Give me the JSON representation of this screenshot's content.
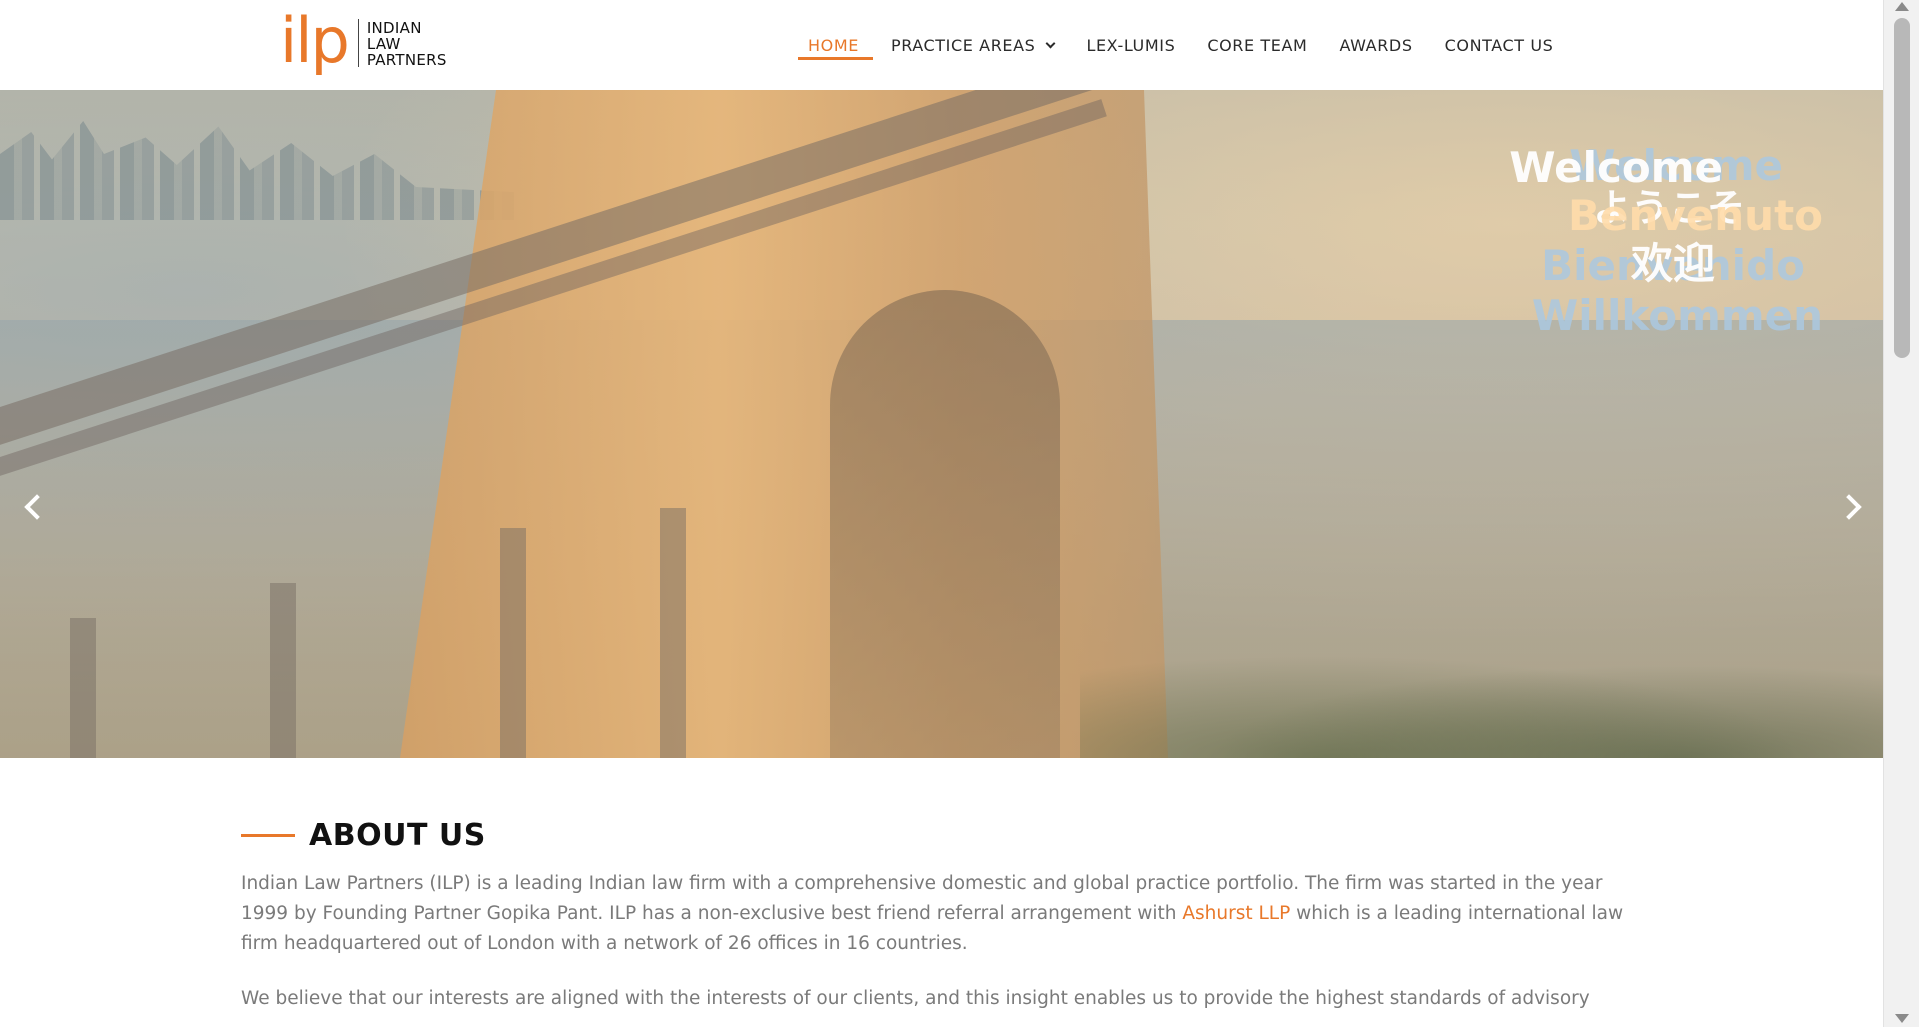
{
  "logo": {
    "mark": "ilp",
    "words": [
      "INDIAN",
      "LAW",
      "PARTNERS"
    ]
  },
  "nav": {
    "items": [
      {
        "label": "HOME",
        "active": true
      },
      {
        "label": "PRACTICE AREAS",
        "has_dropdown": true
      },
      {
        "label": "LEX-LUMIS"
      },
      {
        "label": "CORE TEAM"
      },
      {
        "label": "AWARDS"
      },
      {
        "label": "CONTACT US"
      }
    ],
    "accent_color": "#e8782a"
  },
  "hero": {
    "welcome_texts": [
      "Welcome",
      "ようこそ",
      "Benvenuto",
      "Bienvenido",
      "欢迎",
      "Willkommen"
    ],
    "prev_icon": "chevron-left-icon",
    "next_icon": "chevron-right-icon"
  },
  "about": {
    "title": "ABOUT US",
    "para1_before": "Indian Law Partners (ILP) is a leading Indian law firm with a comprehensive domestic and global practice portfolio. The firm was started in the year 1999 by Founding Partner Gopika Pant. ILP has a non-exclusive best friend referral arrangement with ",
    "para1_link": "Ashurst LLP",
    "para1_after": " which is a leading international law firm headquartered out of London with a network of 26 offices in 16 countries.",
    "para2": "We believe that our interests are aligned with the interests of our clients, and this insight enables us to provide the highest standards of advisory"
  }
}
